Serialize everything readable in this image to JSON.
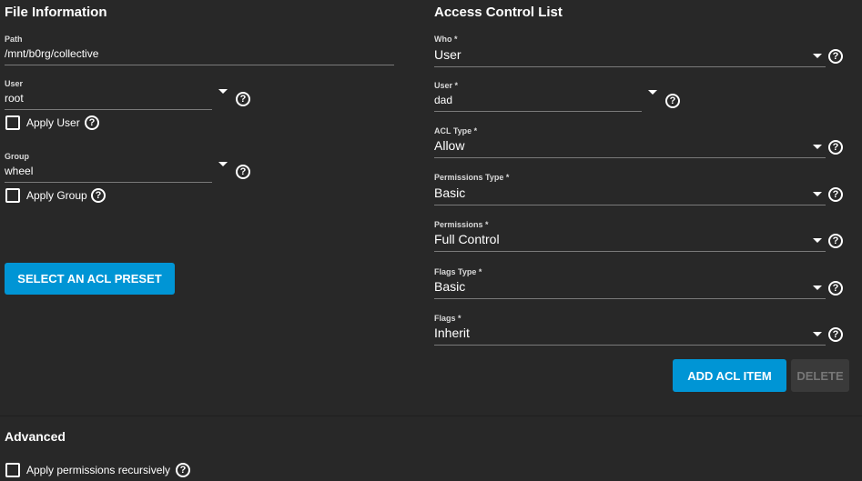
{
  "file_info": {
    "title": "File Information",
    "path": {
      "label": "Path",
      "value": "/mnt/b0rg/collective"
    },
    "user": {
      "label": "User",
      "value": "root",
      "apply_label": "Apply User"
    },
    "group": {
      "label": "Group",
      "value": "wheel",
      "apply_label": "Apply Group"
    },
    "preset_button": "SELECT AN ACL PRESET"
  },
  "acl": {
    "title": "Access Control List",
    "fields": [
      {
        "label": "Who *",
        "value": "User"
      },
      {
        "label": "User *",
        "value": "dad"
      },
      {
        "label": "ACL Type *",
        "value": "Allow"
      },
      {
        "label": "Permissions Type *",
        "value": "Basic"
      },
      {
        "label": "Permissions *",
        "value": "Full Control"
      },
      {
        "label": "Flags Type *",
        "value": "Basic"
      },
      {
        "label": "Flags *",
        "value": "Inherit"
      }
    ],
    "add_button": "ADD ACL ITEM",
    "delete_button": "DELETE"
  },
  "advanced": {
    "title": "Advanced",
    "recursive_label": "Apply permissions recursively"
  },
  "icons": {
    "help": "help-circle-icon",
    "dropdown": "caret-down-icon",
    "checkbox": "checkbox-unchecked"
  },
  "colors": {
    "background": "#282828",
    "primary": "#0095d5",
    "disabled_bg": "#3a3a3a"
  }
}
